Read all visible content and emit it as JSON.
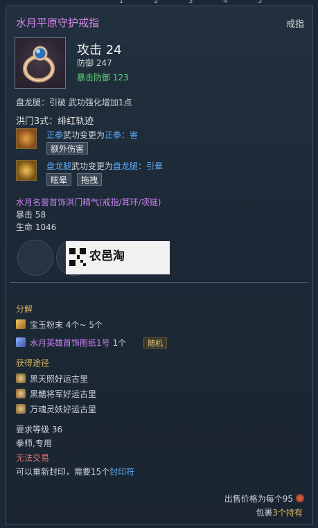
{
  "background": {
    "top_numbers": [
      "1",
      "2",
      "3",
      "4",
      "5"
    ]
  },
  "header": {
    "item_name": "水月平原守护戒指",
    "item_type": "戒指"
  },
  "stats": {
    "attack": "攻击 24",
    "defense": "防御 247",
    "crit_defense": "暴击防御 123"
  },
  "effect_line": "盘龙腿：引破 武功强化增加1点",
  "hongmen": {
    "title": "洪门3式：绯红轨迹",
    "skill1": {
      "name": "正拳",
      "middle": "武功变更为",
      "target": "正拳：害",
      "tags": [
        "额外伤害"
      ]
    },
    "skill2": {
      "name": "盘龙腿",
      "middle": "武功变更为",
      "target": "盘龙腿：引晕",
      "tags": [
        "眩晕",
        "拖拽"
      ]
    }
  },
  "set_bonus": {
    "title": "水月名誉首饰洪门精气(戒指/耳环/项链)",
    "line1": "暴击 58",
    "line2": "生命 1046"
  },
  "watermark": {
    "text": "农邑淘"
  },
  "decompose": {
    "title": "分解",
    "item1": {
      "name": "宝玉粉末",
      "qty": "4个~ 5个"
    },
    "item2": {
      "name": "水月英雄首饰图纸1号",
      "qty": "1个",
      "badge": "随机"
    }
  },
  "obtain": {
    "title": "获得途径",
    "sources": [
      "黑天照好运古里",
      "黑鳍将军好运古里",
      "万魂灵妖好运古里"
    ]
  },
  "requirements": {
    "level": "要求等级 36",
    "class": "拳师,专用",
    "trade": "无法交易",
    "reseal_prefix": "可以重新封印，需要15个",
    "reseal_item": "封印符"
  },
  "footer": {
    "sell_price": "出售价格为每个95",
    "bag_prefix": "包裹",
    "bag_count": "3个持有"
  },
  "colors": {
    "title": "#d98af0",
    "green": "#5fd47a",
    "blue": "#5aa7f2",
    "purple": "#c57ff0",
    "gold": "#d9b65b",
    "red": "#e27070"
  }
}
